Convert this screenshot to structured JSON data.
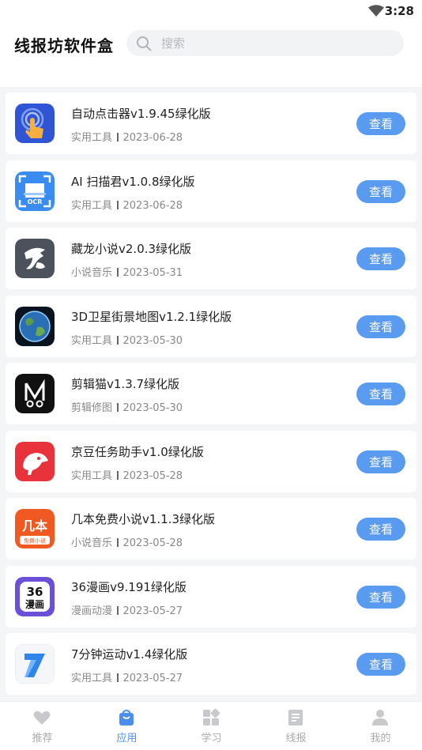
{
  "status": {
    "time": "3:28"
  },
  "header": {
    "title": "线报坊软件盒",
    "search_placeholder": "搜索"
  },
  "view_label": "查看",
  "items": [
    {
      "title": "自动点击器v1.9.45绿化版",
      "category": "实用工具",
      "date": "2023-06-28",
      "icon": "auto-clicker-icon"
    },
    {
      "title": "AI 扫描君v1.0.8绿化版",
      "category": "实用工具",
      "date": "2023-06-28",
      "icon": "ocr-scanner-icon"
    },
    {
      "title": "藏龙小说v2.0.3绿化版",
      "category": "小说音乐",
      "date": "2023-05-31",
      "icon": "canglong-novel-icon"
    },
    {
      "title": "3D卫星街景地图v1.2.1绿化版",
      "category": "实用工具",
      "date": "2023-05-30",
      "icon": "earth-map-icon"
    },
    {
      "title": "剪辑猫v1.3.7绿化版",
      "category": "剪辑修图",
      "date": "2023-05-30",
      "icon": "scissors-cat-icon"
    },
    {
      "title": "京豆任务助手v1.0绿化版",
      "category": "实用工具",
      "date": "2023-05-28",
      "icon": "jd-dog-icon"
    },
    {
      "title": "几本免费小说v1.1.3绿化版",
      "category": "小说音乐",
      "date": "2023-05-28",
      "icon": "jiben-novel-icon"
    },
    {
      "title": "36漫画v9.191绿化版",
      "category": "漫画动漫",
      "date": "2023-05-27",
      "icon": "36-comic-icon"
    },
    {
      "title": "7分钟运动v1.4绿化版",
      "category": "实用工具",
      "date": "2023-05-27",
      "icon": "seven-minute-icon"
    }
  ],
  "icon_text": {
    "ocr": "OCR",
    "jiben_logo": "几本",
    "jiben_sub": "免费小说",
    "comic_36": "36",
    "comic_sub": "漫画"
  },
  "tabs": [
    {
      "label": "推荐",
      "icon": "heart-icon",
      "active": false
    },
    {
      "label": "应用",
      "icon": "bag-icon",
      "active": true
    },
    {
      "label": "学习",
      "icon": "grid-icon",
      "active": false
    },
    {
      "label": "线报",
      "icon": "document-icon",
      "active": false
    },
    {
      "label": "我的",
      "icon": "user-icon",
      "active": false
    }
  ],
  "colors": {
    "accent": "#5a9bf2",
    "tab_active": "#4b8ef0"
  }
}
